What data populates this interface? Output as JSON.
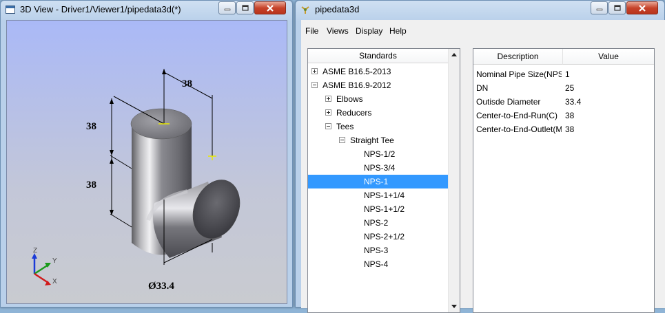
{
  "viewer_window": {
    "title": "3D View - Driver1/Viewer1/pipedata3d(*)",
    "dimensions": {
      "top": "38",
      "left_upper": "38",
      "left_lower": "38",
      "diameter": "Ø33.4"
    },
    "axes": {
      "z": "Z",
      "y": "Y",
      "x": "X"
    }
  },
  "pipedata_window": {
    "title": "pipedata3d",
    "menu": [
      "File",
      "Views",
      "Display",
      "Help"
    ],
    "tree": {
      "header": "Standards",
      "items": [
        {
          "label": "ASME B16.5-2013",
          "expander": "plus"
        },
        {
          "label": "ASME B16.9-2012",
          "expander": "minus"
        },
        {
          "label": "Elbows",
          "expander": "plus"
        },
        {
          "label": "Reducers",
          "expander": "plus"
        },
        {
          "label": "Tees",
          "expander": "minus"
        },
        {
          "label": "Straight Tee",
          "expander": "minus"
        },
        {
          "label": "NPS-1/2"
        },
        {
          "label": "NPS-3/4"
        },
        {
          "label": "NPS-1",
          "selected": true
        },
        {
          "label": "NPS-1+1/4"
        },
        {
          "label": "NPS-1+1/2"
        },
        {
          "label": "NPS-2"
        },
        {
          "label": "NPS-2+1/2"
        },
        {
          "label": "NPS-3"
        },
        {
          "label": "NPS-4"
        }
      ]
    },
    "table": {
      "columns": [
        "Description",
        "Value"
      ],
      "rows": [
        {
          "description": "Nominal Pipe Size(NPS",
          "value": "1"
        },
        {
          "description": "DN",
          "value": "25"
        },
        {
          "description": "Outisde Diameter",
          "value": "33.4"
        },
        {
          "description": "Center-to-End-Run(C)",
          "value": "38"
        },
        {
          "description": "Center-to-End-Outlet(M",
          "value": "38"
        }
      ]
    }
  },
  "colors": {
    "selection": "#3399ff",
    "close_button": "#c7442b"
  }
}
